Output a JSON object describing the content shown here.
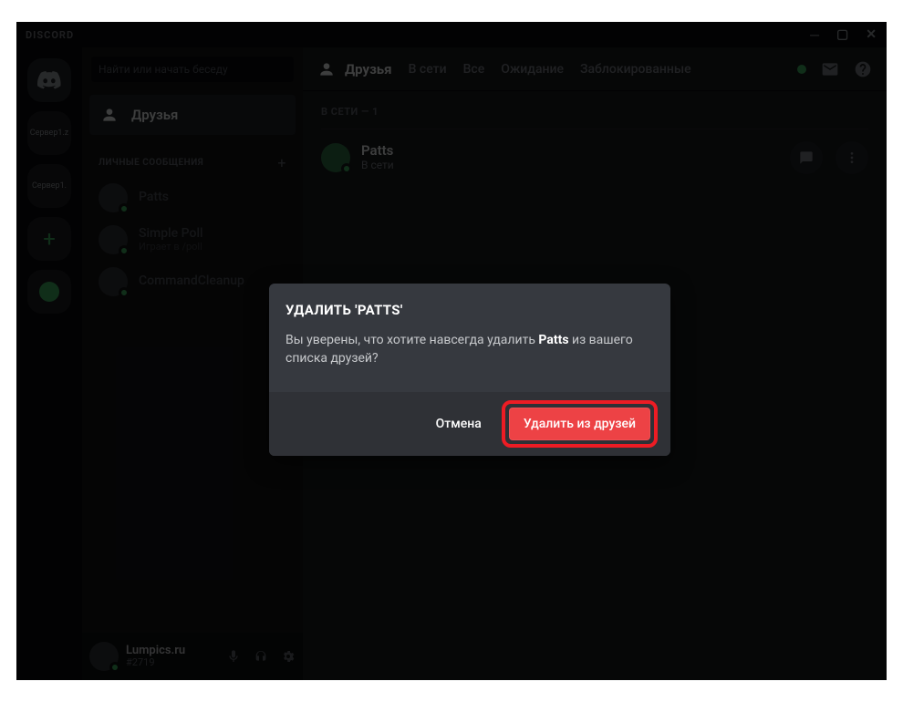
{
  "titlebar": {
    "app_name": "DISCORD"
  },
  "guilds": {
    "servers": [
      "Сервер1.z",
      "Сервер1."
    ]
  },
  "sidebar": {
    "search_placeholder": "Найти или начать беседу",
    "friends_label": "Друзья",
    "dm_header": "ЛИЧНЫЕ СООБЩЕНИЯ",
    "dms": [
      {
        "name": "Patts",
        "sub": ""
      },
      {
        "name": "Simple Poll",
        "sub": "Играет в /poll"
      },
      {
        "name": "CommandCleanup",
        "sub": ""
      }
    ]
  },
  "userbar": {
    "username": "Lumpics.ru",
    "tag": "#2719"
  },
  "topbar": {
    "friends_label": "Друзья",
    "tabs": {
      "online": "В сети",
      "all": "Все",
      "pending": "Ожидание",
      "blocked": "Заблокированные"
    }
  },
  "content": {
    "online_header": "В СЕТИ — 1",
    "friend": {
      "name": "Patts",
      "status": "В сети"
    }
  },
  "modal": {
    "title": "УДАЛИТЬ 'PATTS'",
    "text_before": "Вы уверены, что хотите навсегда удалить ",
    "text_bold": "Patts",
    "text_after": " из вашего списка друзей?",
    "cancel": "Отмена",
    "remove": "Удалить из друзей"
  }
}
